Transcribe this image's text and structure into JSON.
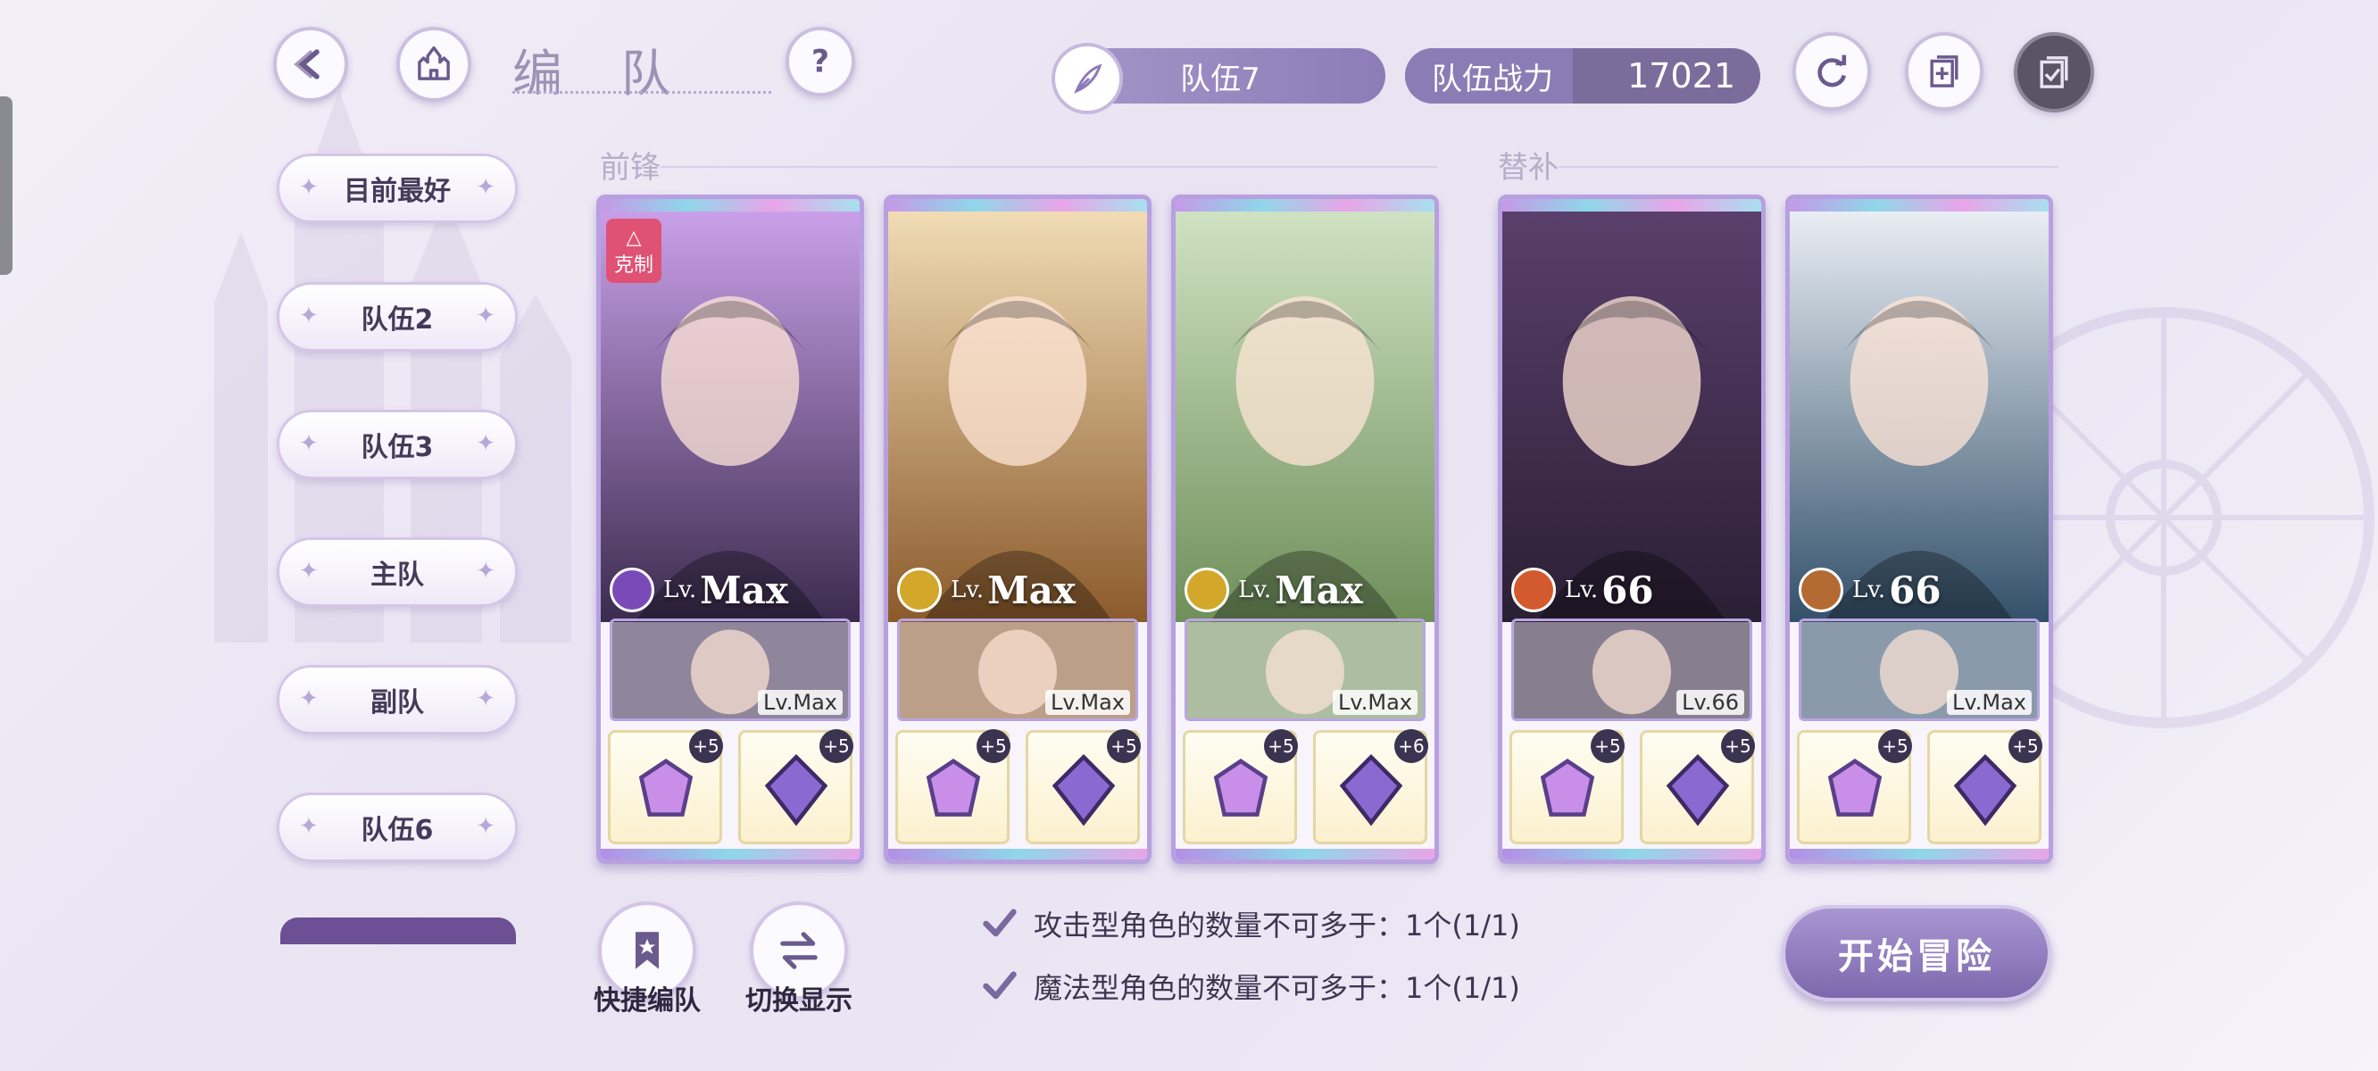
{
  "header": {
    "title": "编 队",
    "team_name": "队伍7",
    "power_label": "队伍战力",
    "power_value": "17021"
  },
  "sidebar": {
    "items": [
      {
        "label": "目前最好"
      },
      {
        "label": "队伍2"
      },
      {
        "label": "队伍3"
      },
      {
        "label": "主队"
      },
      {
        "label": "副队"
      },
      {
        "label": "队伍6"
      }
    ]
  },
  "sections": {
    "front": "前锋",
    "reserve": "替补"
  },
  "restrain_badge": "克制",
  "cards": [
    {
      "lv_prefix": "Lv.",
      "lv": "Max",
      "badge_color": "#7a4bb8",
      "support_lv": "Lv.Max",
      "gear": [
        "+5",
        "+5"
      ],
      "art": [
        "#c9a0e8",
        "#3b2b4e"
      ]
    },
    {
      "lv_prefix": "Lv.",
      "lv": "Max",
      "badge_color": "#d2a72a",
      "support_lv": "Lv.Max",
      "gear": [
        "+5",
        "+5"
      ],
      "art": [
        "#f1dcb5",
        "#8b5a2b"
      ]
    },
    {
      "lv_prefix": "Lv.",
      "lv": "Max",
      "badge_color": "#d2a72a",
      "support_lv": "Lv.Max",
      "gear": [
        "+5",
        "+6"
      ],
      "art": [
        "#cfe2c3",
        "#6f8f5a"
      ]
    },
    {
      "lv_prefix": "Lv.",
      "lv": "66",
      "badge_color": "#d35a2e",
      "support_lv": "Lv.66",
      "gear": [
        "+5",
        "+5"
      ],
      "art": [
        "#5a3f6c",
        "#2b1f34"
      ]
    },
    {
      "lv_prefix": "Lv.",
      "lv": "66",
      "badge_color": "#b36a33",
      "support_lv": "Lv.Max",
      "gear": [
        "+5",
        "+5"
      ],
      "art": [
        "#e9eef4",
        "#33506a"
      ]
    }
  ],
  "bottom_buttons": {
    "quick": "快捷编队",
    "switch": "切换显示"
  },
  "rules": [
    "攻击型角色的数量不可多于：1个(1/1)",
    "魔法型角色的数量不可多于：1个(1/1)"
  ],
  "start_button": "开始冒险",
  "colors": {
    "accent": "#8e7cb8",
    "card_border": "#b8a0e0",
    "restrain": "#e05274"
  },
  "icons": [
    "back-arrow-icon",
    "castle-icon",
    "help-icon",
    "feather-icon",
    "refresh-icon",
    "add-copy-icon",
    "checklist-icon",
    "bookmark-icon",
    "swap-icon",
    "check-icon"
  ]
}
